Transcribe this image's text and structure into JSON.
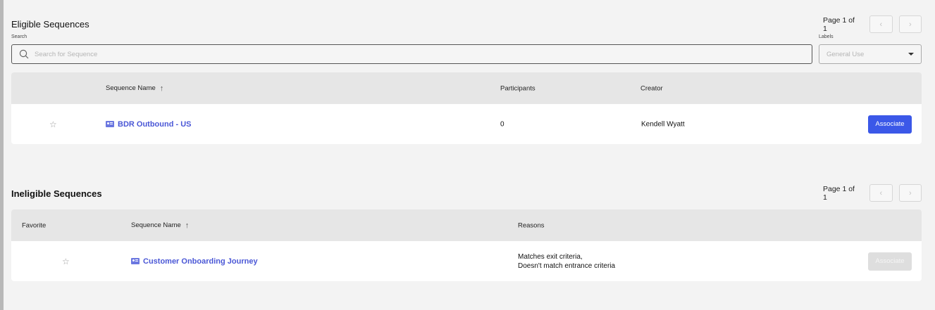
{
  "eligible": {
    "title": "Eligible Sequences",
    "pager": {
      "text": "Page 1 of 1",
      "prev": "‹",
      "next": "›"
    },
    "search": {
      "label": "Search",
      "placeholder": "Search for Sequence"
    },
    "labels": {
      "label": "Labels",
      "selected": "General Use"
    },
    "columns": {
      "name": "Sequence Name",
      "participants": "Participants",
      "creator": "Creator",
      "sort_arrow": "↑"
    },
    "rows": [
      {
        "name": "BDR Outbound - US",
        "participants": "0",
        "creator": "Kendell Wyatt",
        "action": "Associate",
        "star": "☆"
      }
    ]
  },
  "ineligible": {
    "title": "Ineligible Sequences",
    "pager": {
      "text": "Page 1 of 1",
      "prev": "‹",
      "next": "›"
    },
    "columns": {
      "favorite": "Favorite",
      "name": "Sequence Name",
      "reasons": "Reasons",
      "sort_arrow": "↑"
    },
    "rows": [
      {
        "name": "Customer Onboarding Journey",
        "reason_1": "Matches exit criteria,",
        "reason_2": "Doesn't match entrance criteria",
        "action": "Associate",
        "star": "☆"
      }
    ]
  },
  "icons": [
    "search-icon",
    "chevron-left-icon",
    "chevron-right-icon",
    "chevron-down-icon",
    "star-icon",
    "sequence-icon",
    "sort-ascending-icon"
  ],
  "colors": {
    "accent": "#3b58e8",
    "link": "#4a57d6",
    "disabled": "#dedede"
  }
}
